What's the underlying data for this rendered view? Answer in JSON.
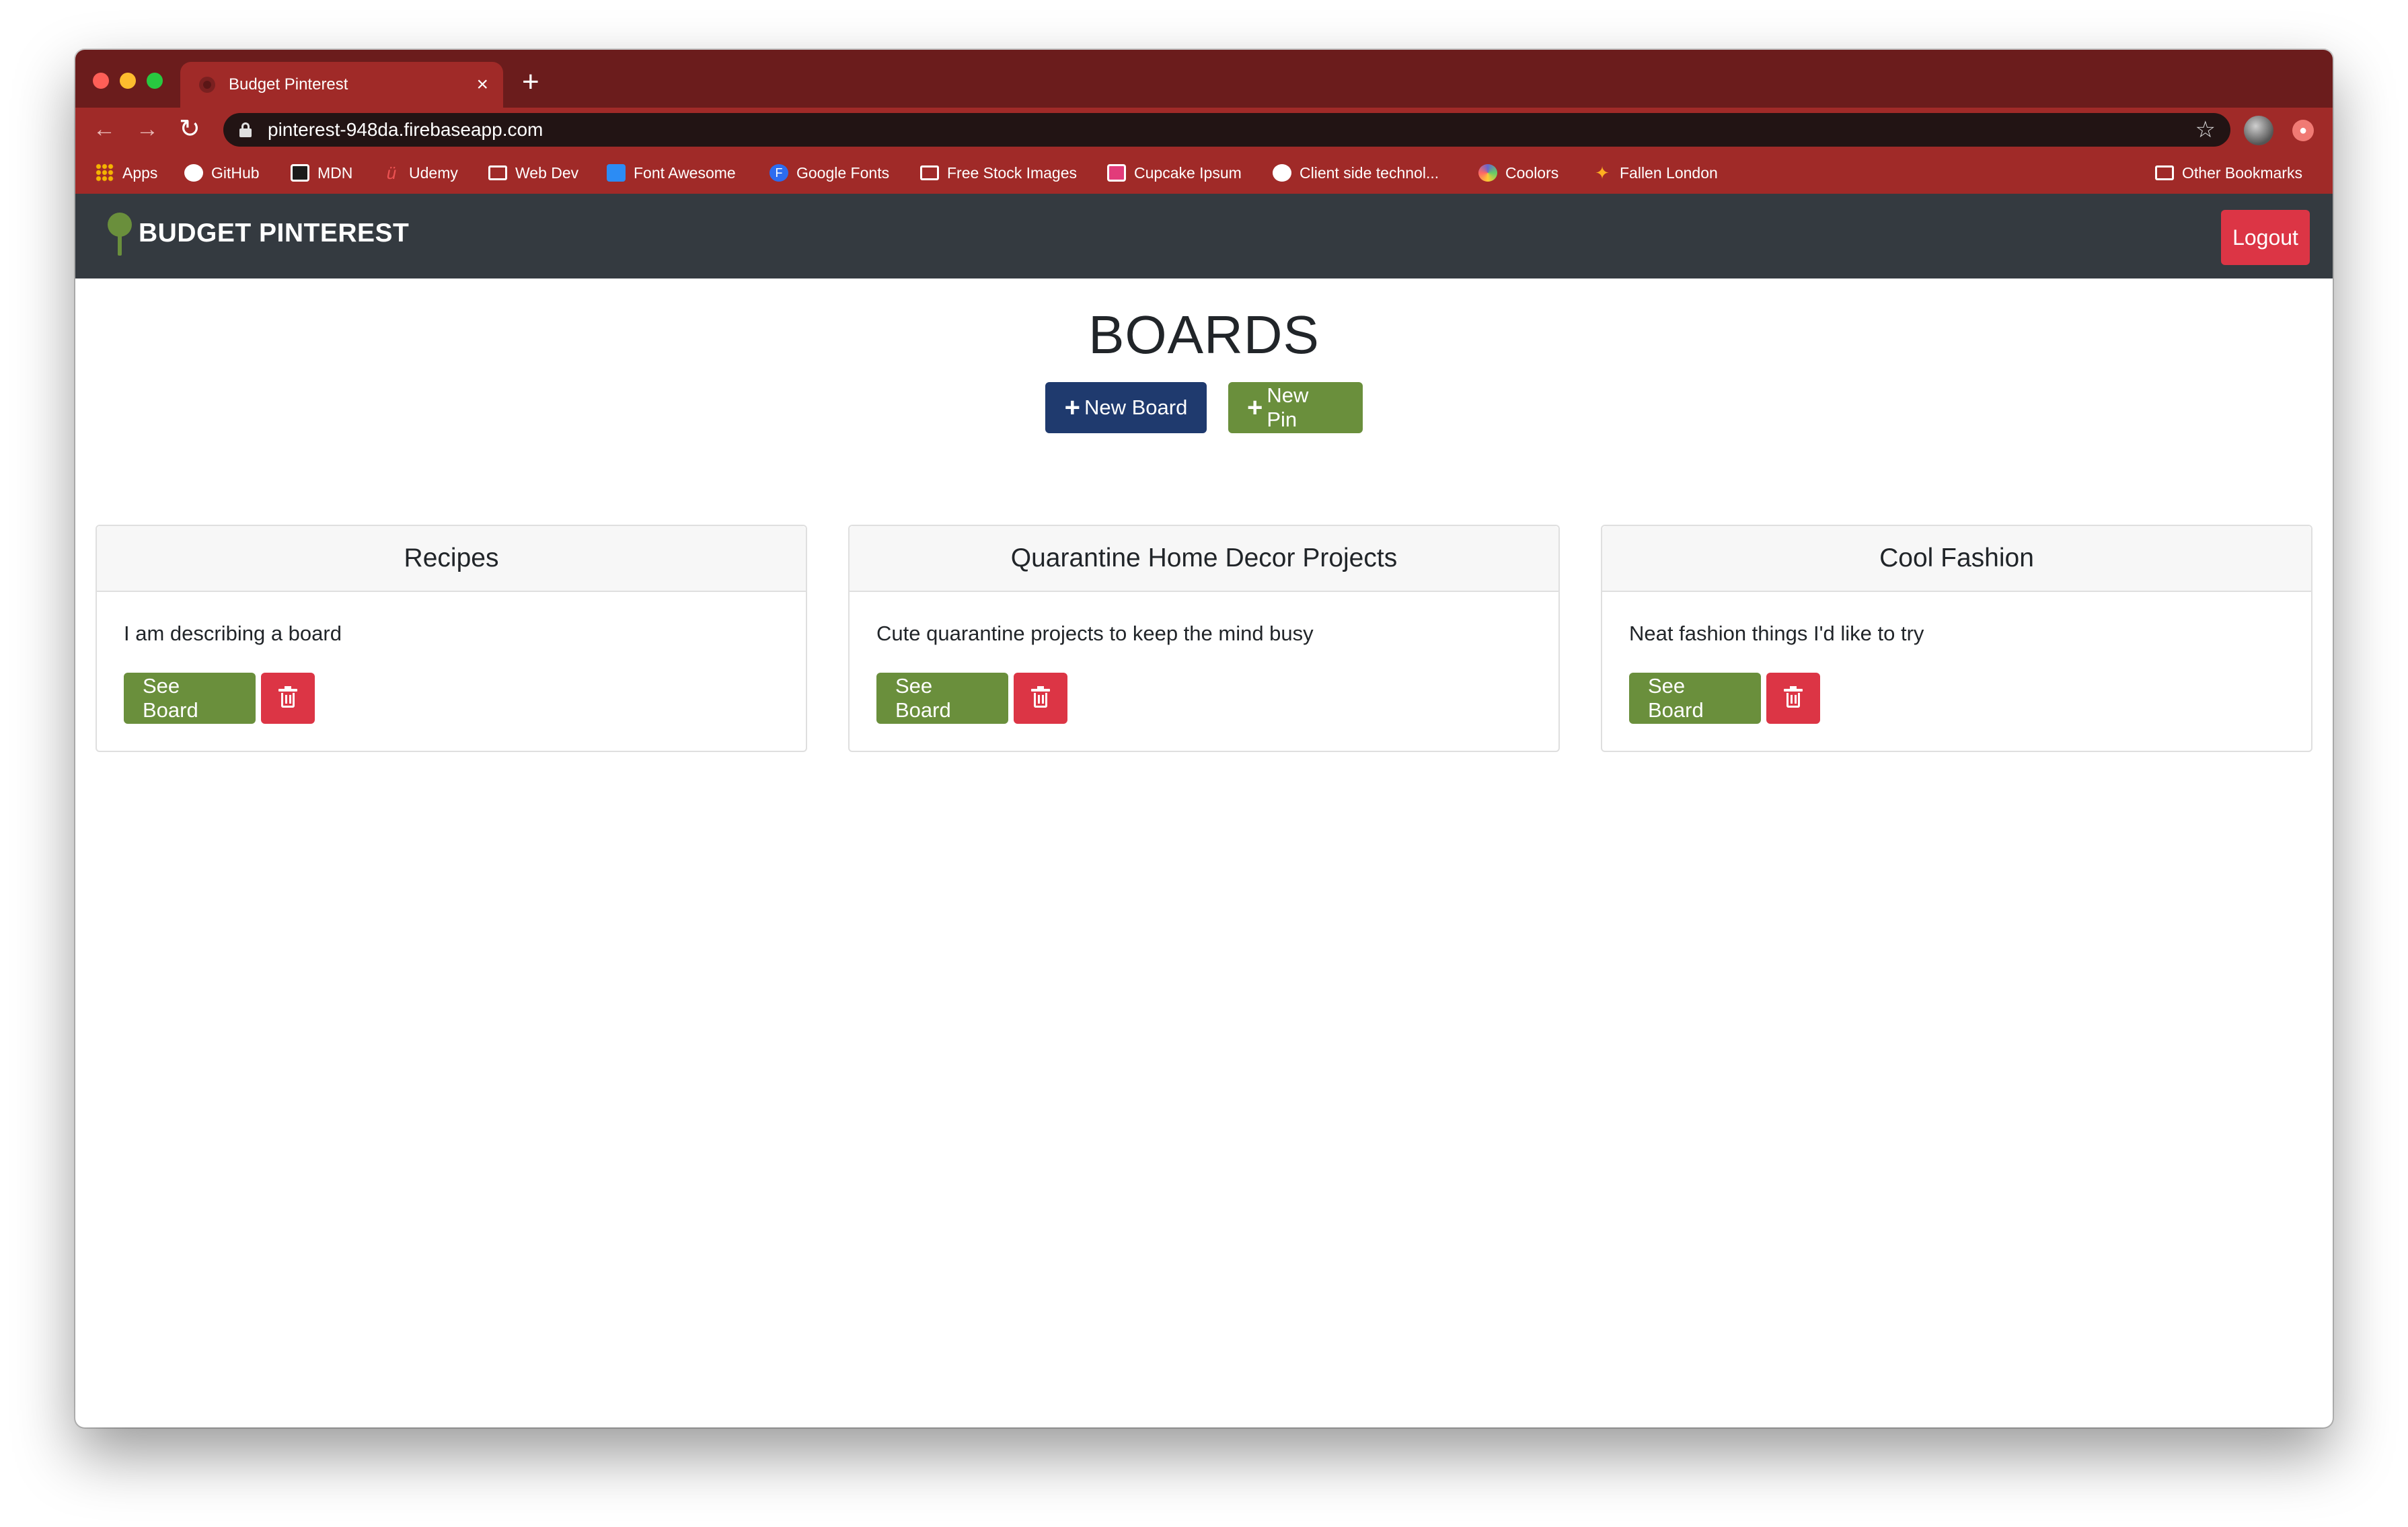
{
  "browser": {
    "tab_title": "Budget Pinterest",
    "tab_close": "×",
    "new_tab": "+",
    "url": "pinterest-948da.firebaseapp.com",
    "nav": {
      "back": "←",
      "forward": "→",
      "reload": "↻",
      "star": "☆"
    },
    "bookmarks": [
      {
        "label": "Apps",
        "icon": "apps-grid-icon"
      },
      {
        "label": "GitHub",
        "icon": "github-icon"
      },
      {
        "label": "MDN",
        "icon": "mdn-icon"
      },
      {
        "label": "Udemy",
        "icon": "udemy-icon"
      },
      {
        "label": "Web Dev",
        "icon": "folder-icon"
      },
      {
        "label": "Font Awesome",
        "icon": "font-awesome-icon"
      },
      {
        "label": "Google Fonts",
        "icon": "google-fonts-icon"
      },
      {
        "label": "Free Stock Images",
        "icon": "folder-icon"
      },
      {
        "label": "Cupcake Ipsum",
        "icon": "cupcake-icon"
      },
      {
        "label": "Client side technol...",
        "icon": "github-icon"
      },
      {
        "label": "Coolors",
        "icon": "coolors-icon"
      },
      {
        "label": "Fallen London",
        "icon": "fallen-london-icon"
      },
      {
        "label": "Other Bookmarks",
        "icon": "folder-icon"
      }
    ]
  },
  "navbar": {
    "brand": "BUDGET PINTEREST",
    "logout": "Logout"
  },
  "main": {
    "title": "BOARDS",
    "new_board": "New Board",
    "new_pin": "New Pin",
    "plus": "+"
  },
  "boards": [
    {
      "title": "Recipes",
      "description": "I am describing a board",
      "see_label": "See Board"
    },
    {
      "title": "Quarantine Home Decor Projects",
      "description": "Cute quarantine projects to keep the mind busy",
      "see_label": "See Board"
    },
    {
      "title": "Cool Fashion",
      "description": "Neat fashion things I'd like to try",
      "see_label": "See Board"
    }
  ],
  "colors": {
    "tabstrip": "#6b1c1c",
    "toolbar": "#a02a28",
    "navbar": "#343a40",
    "primary": "#1f3a6e",
    "success": "#6a8f3c",
    "danger": "#dc3545"
  }
}
